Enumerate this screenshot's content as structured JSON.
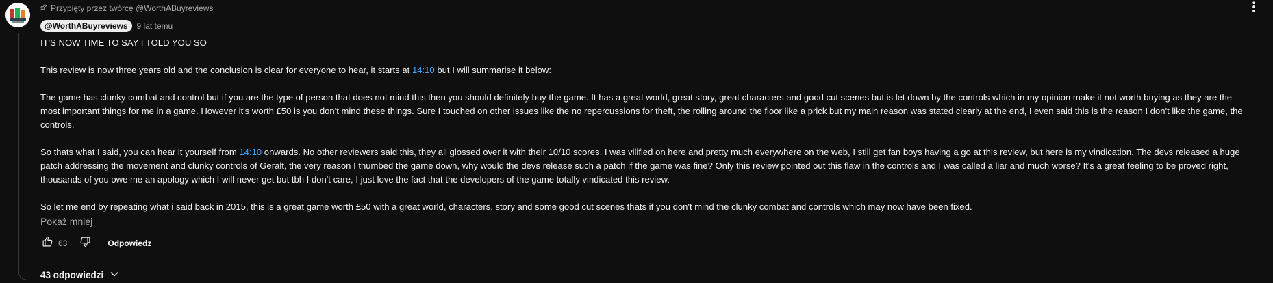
{
  "comment": {
    "pinned_label": "Przypięty przez twórcę @WorthABuyreviews",
    "author": "@WorthABuyreviews",
    "timestamp": "9 lat temu",
    "paragraphs": [
      {
        "segments": [
          "IT'S NOW TIME TO SAY I TOLD YOU SO"
        ]
      },
      {
        "segments": [
          "This review is now three years old and the conclusion is clear for everyone to hear, it starts at ",
          "14:10",
          " but I will summarise it below:"
        ]
      },
      {
        "segments": [
          "The game has clunky combat and control but if you are the type of person that does not mind this then you should definitely buy the game.  It has a great world, great story, great characters and good cut scenes but is let down by the controls which in my opinion make it not worth buying as they are the most important things for me in a game.  However it's worth £50 is you don't mind these things.  Sure I touched on other issues like the no repercussions for theft, the rolling around the floor like a prick but my main reason was stated clearly at the end, I even said this is the reason I don't like the game, the controls."
        ]
      },
      {
        "segments": [
          "So thats what I said, you can hear it yourself from ",
          "14:10",
          " onwards.  No other reviewers said this, they all glossed over it with their 10/10 scores.  I was vilified on here and pretty much everywhere on the web, I still get fan boys having a go at this review, but here is my vindication.  The devs released a huge patch addressing the movement and clunky controls of Geralt, the very reason I thumbed the game down, why would the devs release such a patch if the game was fine?  Only this review pointed out this flaw in the controls and I was called a liar and much worse?  It's a great feeling to be proved right, thousands of you owe me an apology which I will never get but tbh I don't care, I just love the fact that the developers of the game totally vindicated this review."
        ]
      },
      {
        "segments": [
          "So let me end by repeating what i said back in 2015, this is a great game worth £50 with a great world, characters, story and some good cut scenes thats if you don't mind the clunky combat and controls which may now have been fixed."
        ]
      }
    ],
    "show_less_label": "Pokaż mniej",
    "like_count": "63",
    "reply_label": "Odpowiedz",
    "replies_label": "43 odpowiedzi"
  },
  "icons": {
    "pin": "pin-icon",
    "more": "more-vert-icon",
    "like": "thumb-up-icon",
    "dislike": "thumb-down-icon",
    "expand": "chevron-down-icon"
  },
  "colors": {
    "background": "#0f0f0f",
    "text": "#f1f1f1",
    "secondary_text": "#aaaaaa",
    "link": "#3ea6ff",
    "author_chip_bg": "#ececec"
  }
}
